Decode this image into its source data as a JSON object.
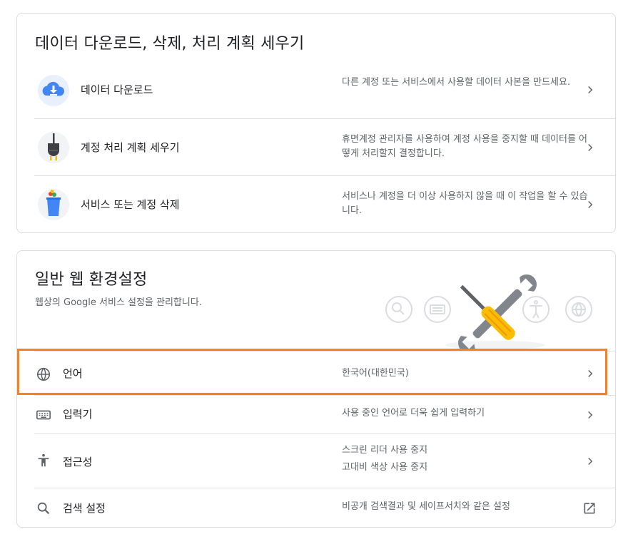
{
  "data_section": {
    "title": "데이터 다운로드, 삭제, 처리 계획 세우기",
    "rows": [
      {
        "label": "데이터 다운로드",
        "desc": "다른 계정 또는 서비스에서 사용할 데이터 사본을 만드세요.",
        "icon": "cloud-download-icon"
      },
      {
        "label": "계정 처리 계획 세우기",
        "desc": "휴면계정 관리자를 사용하여 계정 사용을 중지할 때 데이터를 어떻게 처리할지 결정합니다.",
        "icon": "plug-icon"
      },
      {
        "label": "서비스 또는 계정 삭제",
        "desc": "서비스나 계정을 더 이상 사용하지 않을 때 이 작업을 할 수 있습니다.",
        "icon": "trash-bin-icon"
      }
    ]
  },
  "general_section": {
    "title": "일반 웹 환경설정",
    "subtitle": "웹상의 Google 서비스 설정을 관리합니다.",
    "rows": [
      {
        "label": "언어",
        "desc": "한국어(대한민국)",
        "icon": "globe-icon"
      },
      {
        "label": "입력기",
        "desc": "사용 중인 언어로 더욱 쉽게 입력하기",
        "icon": "keyboard-icon"
      },
      {
        "label": "접근성",
        "desc1": "스크린 리더 사용 중지",
        "desc2": "고대비 색상 사용 중지",
        "icon": "accessibility-icon"
      },
      {
        "label": "검색 설정",
        "desc": "비공개 검색결과 및 세이프서치와 같은 설정",
        "icon": "search-icon",
        "action_icon": "open-in-new-icon"
      }
    ]
  },
  "colors": {
    "highlight": "#f5821f",
    "accent_blue": "#4285f4",
    "text_primary": "#202124",
    "text_secondary": "#5f6368"
  }
}
